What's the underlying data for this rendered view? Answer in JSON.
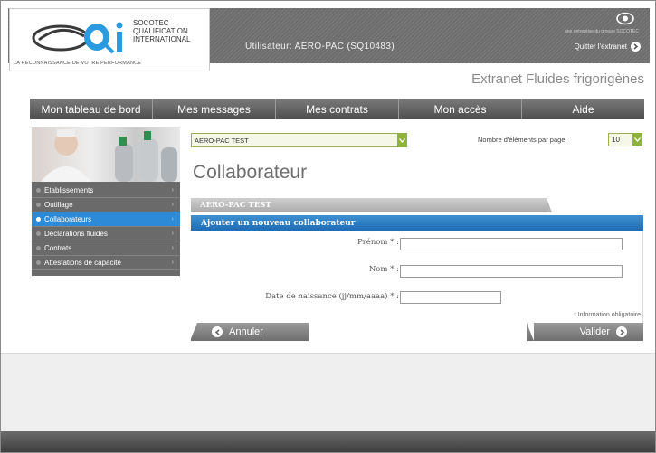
{
  "header": {
    "logo_lines": [
      "SOCOTEC",
      "QUALIFICATION",
      "INTERNATIONAL"
    ],
    "logo_tagline": "LA RECONNAISSANCE DE VOTRE PERFORMANCE",
    "user_line": "Utilisateur: AERO-PAC (SQ10483)",
    "group_text": "une entreprise du groupe SOCOTEC",
    "logout_label": "Quitter l'extranet",
    "site_title": "Extranet Fluides frigorigènes"
  },
  "nav": {
    "items": [
      "Mon tableau de bord",
      "Mes messages",
      "Mes contrats",
      "Mon accès",
      "Aide"
    ]
  },
  "sidebar": {
    "items": [
      {
        "label": "Etablissements",
        "active": false
      },
      {
        "label": "Outillage",
        "active": false
      },
      {
        "label": "Collaborateurs",
        "active": true
      },
      {
        "label": "Déclarations fluides",
        "active": false
      },
      {
        "label": "Contrats",
        "active": false
      },
      {
        "label": "Attestations de capacité",
        "active": false
      }
    ]
  },
  "filters": {
    "organization_value": "AERO-PAC TEST",
    "per_page_label": "Nombre d'éléments par page:",
    "per_page_value": "10"
  },
  "main": {
    "page_title": "Collaborateur",
    "tab_label": "AERO-PAC TEST",
    "form_title": "Ajouter un nouveau collaborateur",
    "fields": {
      "first_name_label": "Prénom * :",
      "last_name_label": "Nom * :",
      "birth_date_label": "Date de naissance (jj/mm/aaaa) * :"
    },
    "required_note": "* Information obligatoire",
    "cancel_label": "Annuler",
    "submit_label": "Valider"
  },
  "colors": {
    "accent_blue": "#2d8ad6",
    "select_green": "#8fb23a",
    "nav_gray": "#5a5a5a"
  }
}
